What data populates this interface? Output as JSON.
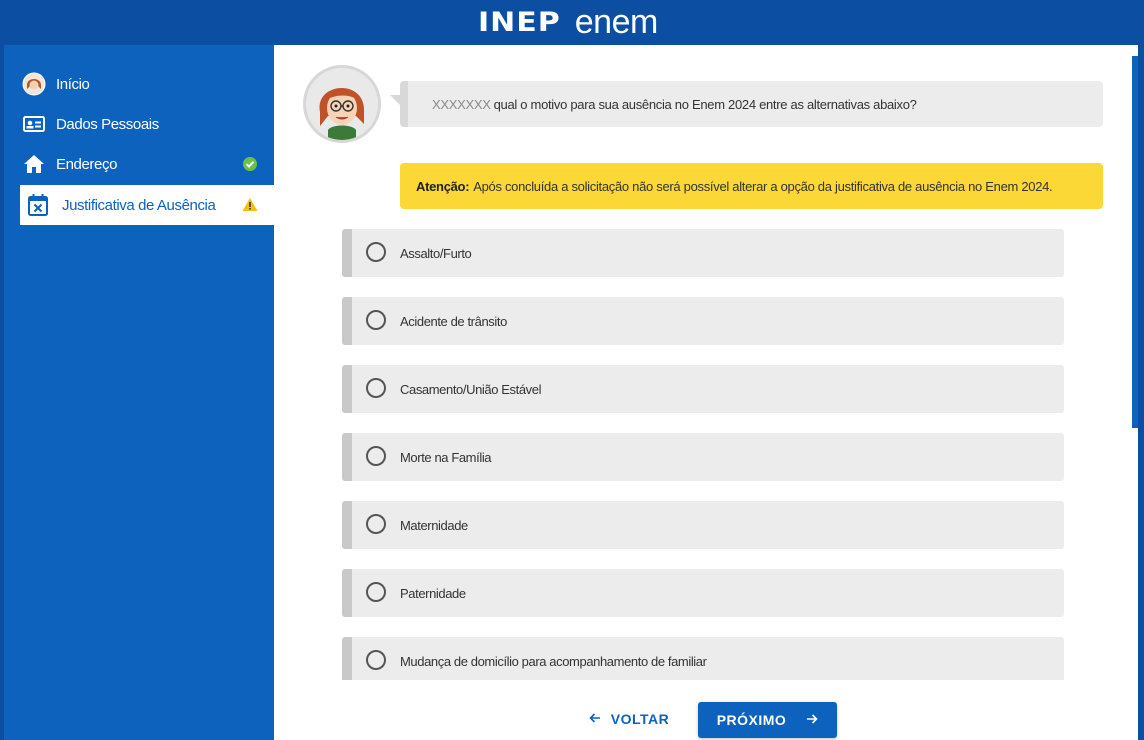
{
  "header": {
    "brand_inep": "INEP",
    "brand_enem": "enem",
    "bg_color": "#0b4ea2"
  },
  "sidebar": {
    "items": [
      {
        "label": "Início",
        "icon": "avatar-icon",
        "status": null
      },
      {
        "label": "Dados Pessoais",
        "icon": "id-card-icon",
        "status": null
      },
      {
        "label": "Endereço",
        "icon": "home-icon",
        "status": "check-icon"
      },
      {
        "label": "Justificativa de Ausência",
        "icon": "calendar-x-icon",
        "status": "warning-icon",
        "active": true
      }
    ],
    "bg_color": "#0c62bd"
  },
  "question": {
    "user_name": "XXXXXXX",
    "text": "qual o motivo para sua ausência no Enem 2024 entre as alternativas abaixo?"
  },
  "alert": {
    "label": "Atenção:",
    "text": "Após concluída a solicitação não será possível alterar a opção da justificativa de ausência no Enem 2024.",
    "color": "#fcd837"
  },
  "options": [
    "Assalto/Furto",
    "Acidente de trânsito",
    "Casamento/União Estável",
    "Morte na Família",
    "Maternidade",
    "Paternidade",
    "Mudança de domicílio para acompanhamento de familiar"
  ],
  "nav": {
    "back_label": "VOLTAR",
    "next_label": "PRÓXIMO"
  }
}
